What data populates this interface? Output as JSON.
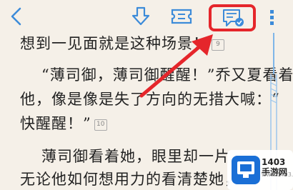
{
  "toolbar": {
    "icons": [
      "back-icon",
      "download-icon",
      "ticket-icon",
      "comment-icon",
      "more-icon"
    ],
    "highlight_color": "#e5262b",
    "icon_color": "#3c8bd9"
  },
  "text": {
    "line1": "想到一见面就是这种场景！",
    "fn1": "9",
    "line2": "“薄司御，薄司御醒醒！”乔又夏看着",
    "line3": "他，像是像是失了方向的无措大喊：“",
    "line4": "快醒醒！”",
    "fn2": "10",
    "line5": "薄司御看着她，眼里却一片",
    "line6": "无论他如何想用力的看清楚她，"
  },
  "watermark": {
    "name": "1403手游网",
    "sub": "www.1403.com"
  }
}
